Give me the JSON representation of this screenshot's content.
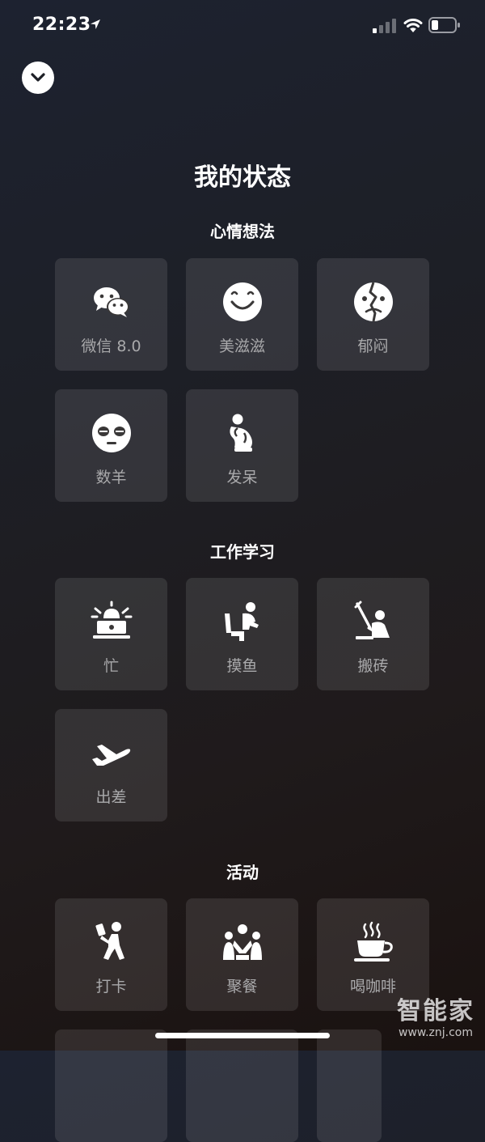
{
  "status_bar": {
    "time": "22:23",
    "icons": [
      "location-arrow-icon",
      "cellular-signal-icon",
      "wifi-icon",
      "battery-icon"
    ]
  },
  "header": {
    "collapse_icon": "chevron-down-icon",
    "title": "我的状态"
  },
  "sections": [
    {
      "title": "心情想法",
      "items": [
        {
          "label": "微信 8.0",
          "icon": "wechat-icon"
        },
        {
          "label": "美滋滋",
          "icon": "smiley-icon"
        },
        {
          "label": "郁闷",
          "icon": "cracked-face-icon"
        },
        {
          "label": "数羊",
          "icon": "sheep-face-icon"
        },
        {
          "label": "发呆",
          "icon": "thinker-icon"
        }
      ]
    },
    {
      "title": "工作学习",
      "items": [
        {
          "label": "忙",
          "icon": "alarm-desk-icon"
        },
        {
          "label": "摸鱼",
          "icon": "slacking-person-icon"
        },
        {
          "label": "搬砖",
          "icon": "laborer-icon"
        },
        {
          "label": "出差",
          "icon": "airplane-icon"
        }
      ]
    },
    {
      "title": "活动",
      "items": [
        {
          "label": "打卡",
          "icon": "check-in-person-icon"
        },
        {
          "label": "聚餐",
          "icon": "group-dinner-icon"
        },
        {
          "label": "喝咖啡",
          "icon": "coffee-cup-icon"
        }
      ]
    }
  ],
  "watermark": {
    "name": "智能家",
    "url": "www.znj.com"
  }
}
